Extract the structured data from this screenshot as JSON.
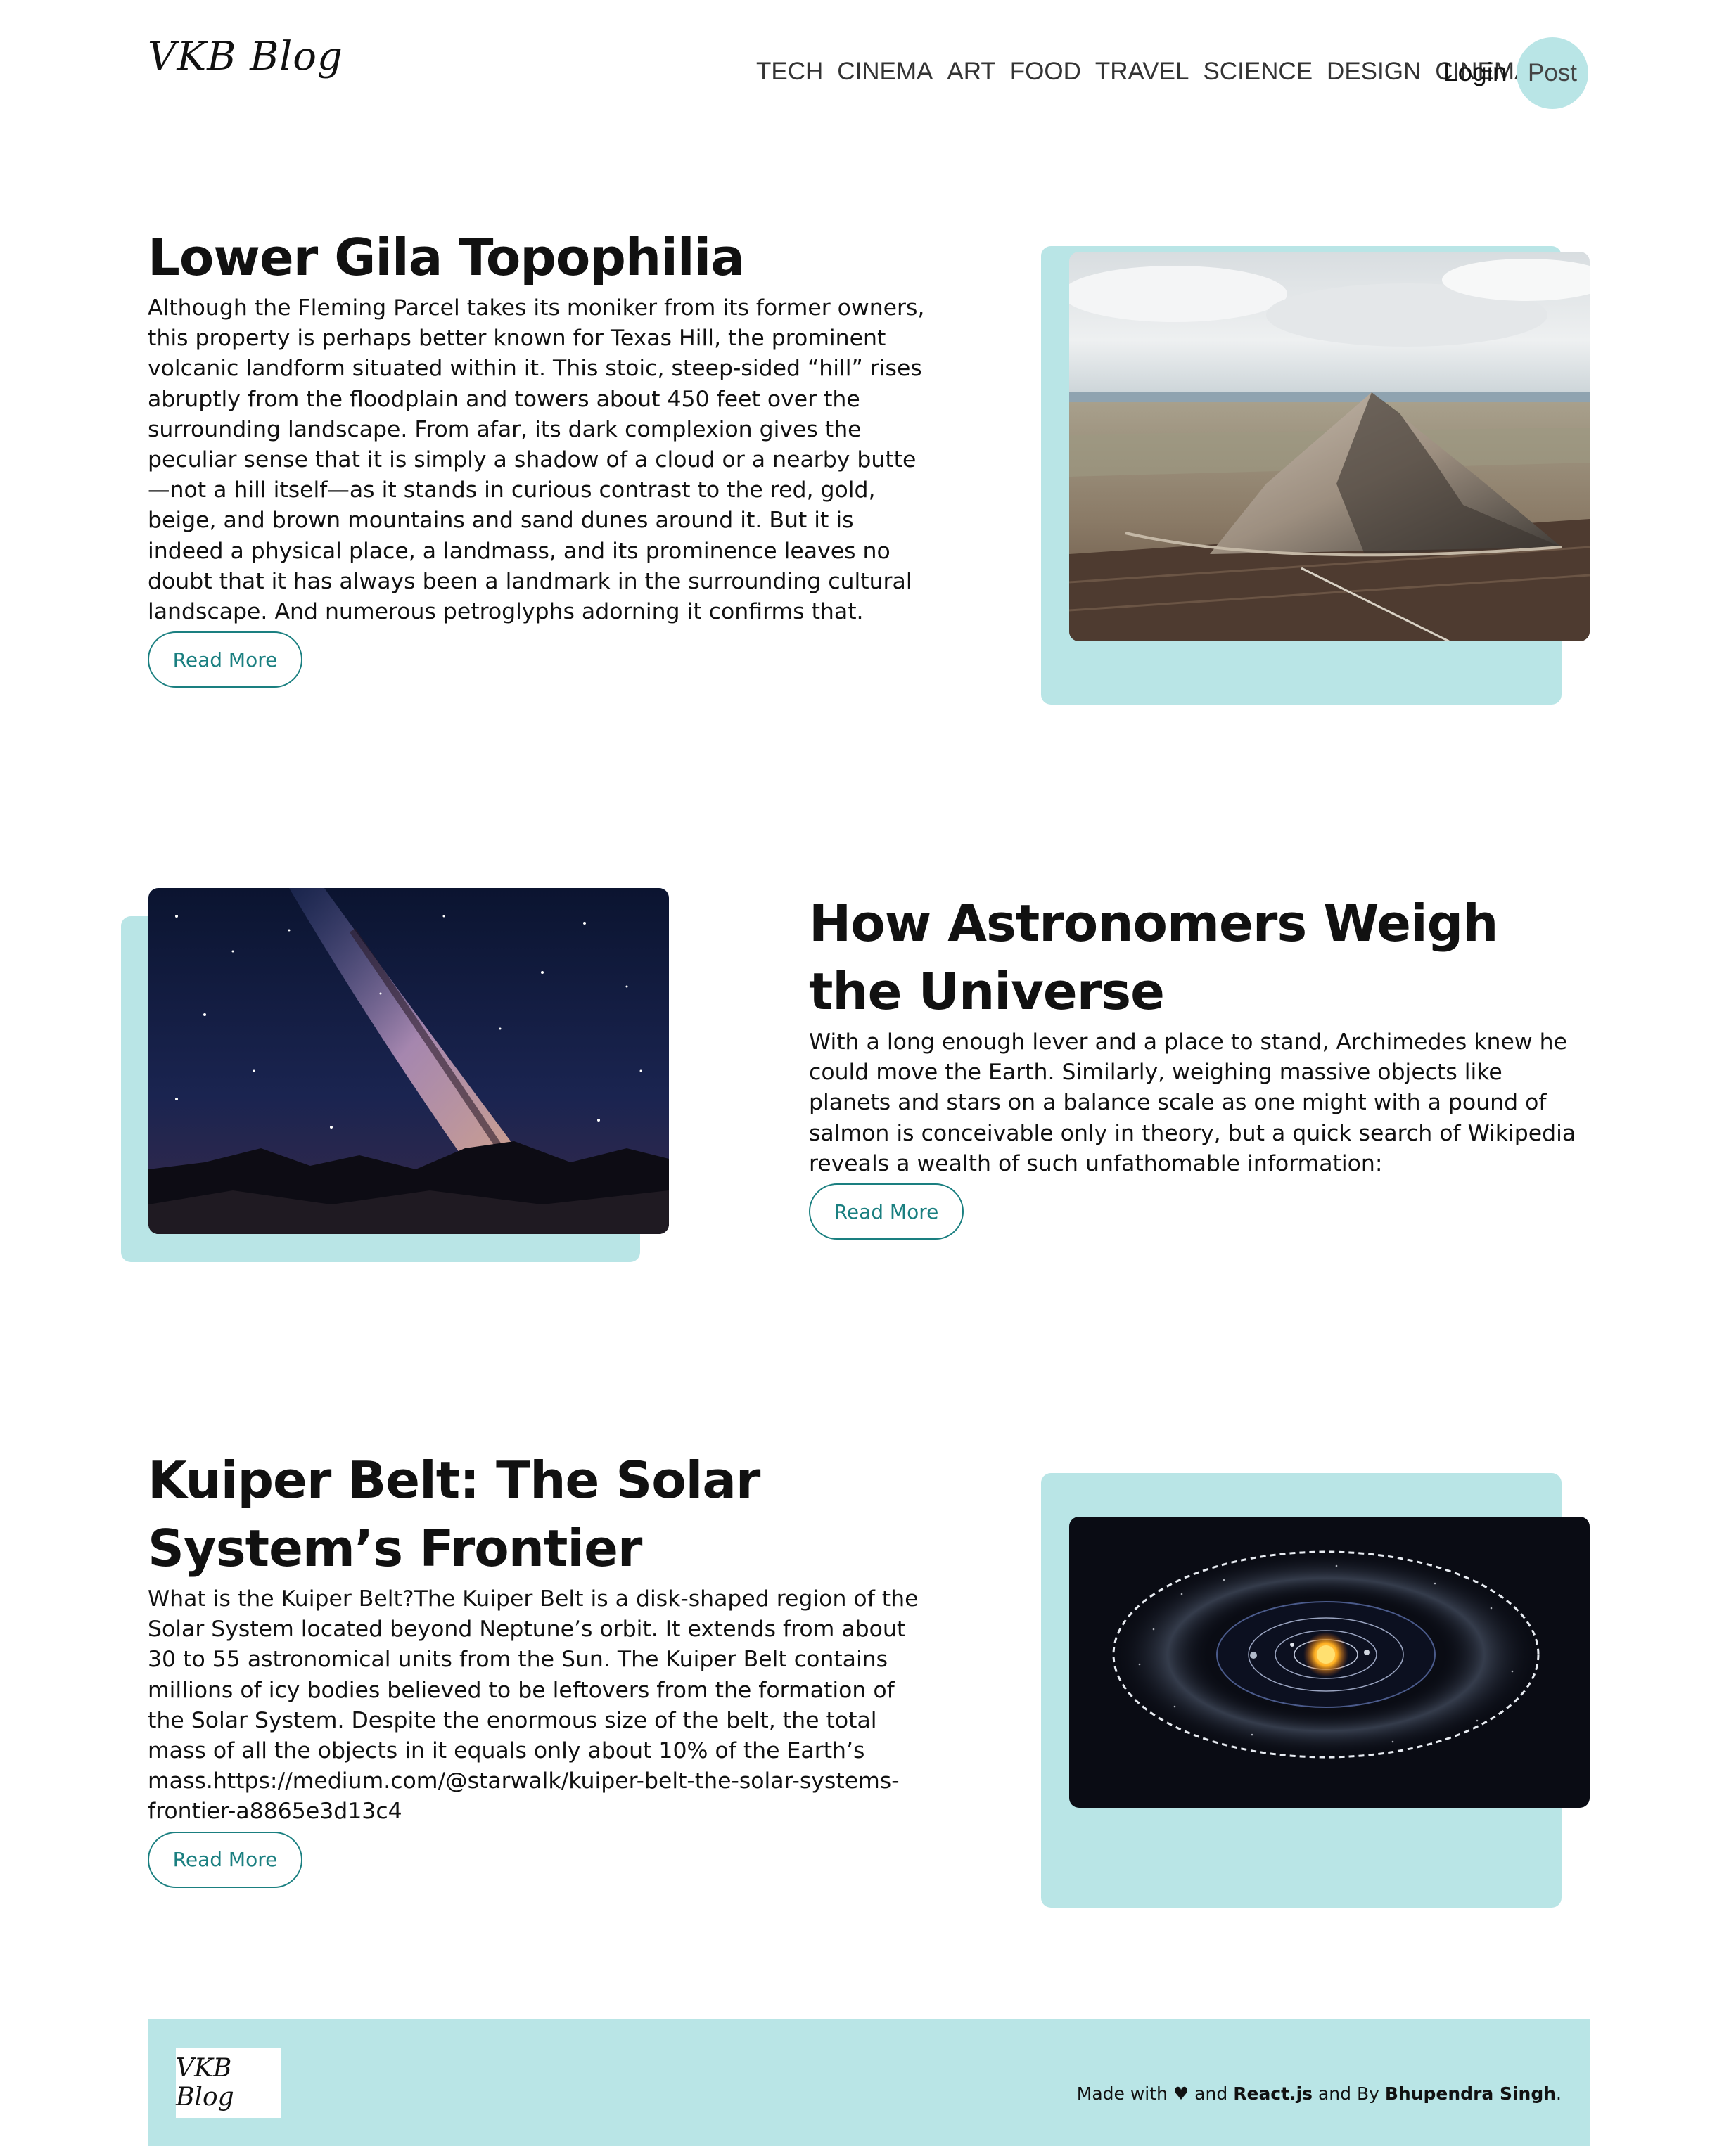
{
  "header": {
    "logo": "VKB Blog",
    "nav": [
      "TECH",
      "CINEMA",
      "ART",
      "FOOD",
      "TRAVEL",
      "SCIENCE",
      "DESIGN",
      "CINEMA"
    ],
    "login": "Login",
    "post": "Post"
  },
  "posts": [
    {
      "title": "Lower Gila Topophilia",
      "desc": "Although the Fleming Parcel takes its moniker from its former owners, this property is perhaps better known for Texas Hill, the prominent volcanic landform situated within it. This stoic, steep-sided “hill” rises abruptly from the floodplain and towers about 450 feet over the surrounding landscape. From afar, its dark complexion gives the peculiar sense that it is simply a shadow of a cloud or a nearby butte—not a hill itself—as it stands in curious contrast to the red, gold, beige, and brown mountains and sand dunes around it. But it is indeed a physical place, a landmass, and its prominence leaves no doubt that it has always been a landmark in the surrounding cultural landscape. And numerous petroglyphs adorning it confirms that.",
      "button": "Read More"
    },
    {
      "title": "How Astronomers Weigh the Universe",
      "desc": "With a long enough lever and a place to stand, Archimedes knew he could move the Earth. Similarly, weighing massive objects like planets and stars on a balance scale as one might with a pound of salmon is conceivable only in theory, but a quick search of Wikipedia reveals a wealth of such unfathomable information:",
      "button": "Read More"
    },
    {
      "title": "Kuiper Belt: The Solar System’s Frontier",
      "desc": "What is the Kuiper Belt?The Kuiper Belt is a disk-shaped region of the Solar System located beyond Neptune’s orbit. It extends from about 30 to 55 astronomical units from the Sun. The Kuiper Belt contains millions of icy bodies believed to be leftovers from the formation of the Solar System. Despite the enormous size of the belt, the total mass of all the objects in it equals only about 10% of the Earth’s mass.https://medium.com/@starwalk/kuiper-belt-the-solar-systems-frontier-a8865e3d13c4",
      "button": "Read More"
    }
  ],
  "footer": {
    "logo": "VKB Blog",
    "made_with": "Made with",
    "heart": "♥",
    "and": "and",
    "tech": "React.js",
    "and_by": "and By",
    "author": "Bhupendra Singh",
    "period": "."
  }
}
